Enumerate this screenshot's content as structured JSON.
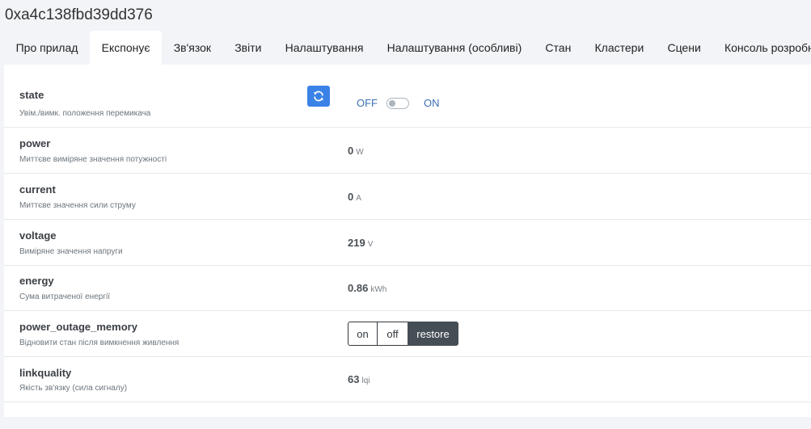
{
  "device_title": "0xa4c138fbd39dd376",
  "tabs": [
    {
      "label": "Про прилад",
      "active": false
    },
    {
      "label": "Експонує",
      "active": true
    },
    {
      "label": "Зв'язок",
      "active": false
    },
    {
      "label": "Звіти",
      "active": false
    },
    {
      "label": "Налаштування",
      "active": false
    },
    {
      "label": "Налаштування (особливі)",
      "active": false
    },
    {
      "label": "Стан",
      "active": false
    },
    {
      "label": "Кластери",
      "active": false
    },
    {
      "label": "Сцени",
      "active": false
    },
    {
      "label": "Консоль розробника",
      "active": false
    }
  ],
  "exposes": {
    "state": {
      "name": "state",
      "description": "Увім./вимк. положення перемикача",
      "refresh_icon": "refresh-icon",
      "off_label": "OFF",
      "on_label": "ON",
      "toggled_on": false
    },
    "power": {
      "name": "power",
      "description": "Миттєве виміряне значення потужності",
      "value": "0",
      "unit": "W"
    },
    "current": {
      "name": "current",
      "description": "Миттєве значення сили струму",
      "value": "0",
      "unit": "A"
    },
    "voltage": {
      "name": "voltage",
      "description": "Виміряне значення напруги",
      "value": "219",
      "unit": "V"
    },
    "energy": {
      "name": "energy",
      "description": "Сума витраченої енергії",
      "value": "0.86",
      "unit": "kWh"
    },
    "power_outage_memory": {
      "name": "power_outage_memory",
      "description": "Відновити стан після вимкнення живлення",
      "options": [
        "on",
        "off",
        "restore"
      ],
      "selected": "restore"
    },
    "linkquality": {
      "name": "linkquality",
      "description": "Якість зв'язку (сила сигналу)",
      "value": "63",
      "unit": "lqi"
    }
  },
  "colors": {
    "accent": "#3b82e6",
    "selected_segment": "#454d55"
  }
}
